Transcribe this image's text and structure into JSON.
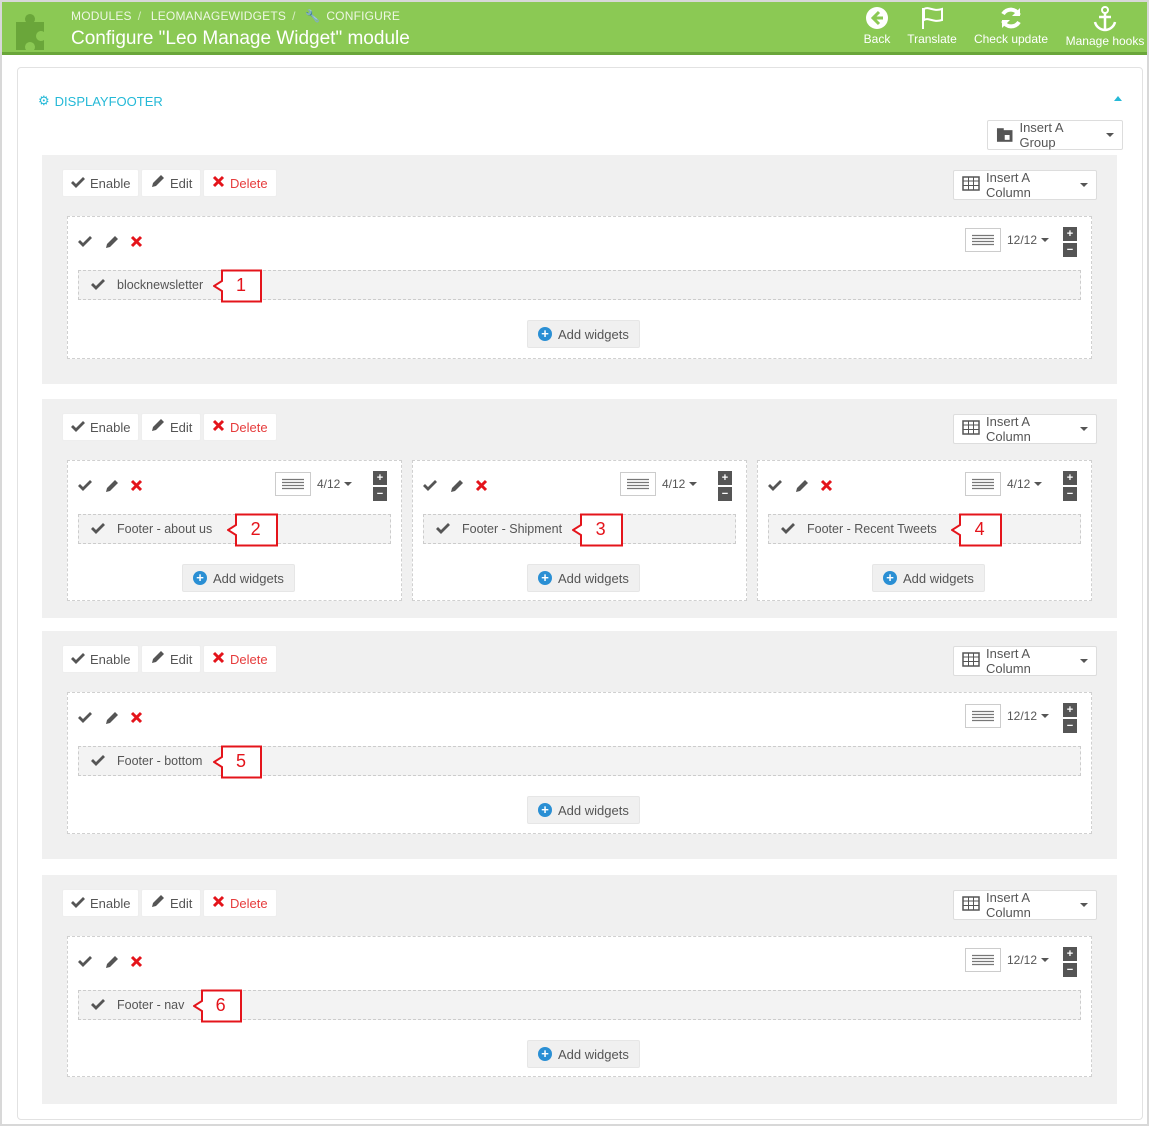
{
  "header": {
    "breadcrumb": [
      "MODULES",
      "LEOMANAGEWIDGETS",
      "CONFIGURE"
    ],
    "title": "Configure \"Leo Manage Widget\" module",
    "toolbar": {
      "back": "Back",
      "translate": "Translate",
      "check_update": "Check update",
      "manage_hooks": "Manage hooks"
    },
    "colors": {
      "bar": "#8bc954",
      "accent": "#25b9d7"
    }
  },
  "panel": {
    "title": "DISPLAYFOOTER",
    "insert_group": "Insert A Group"
  },
  "labels": {
    "enable": "Enable",
    "edit": "Edit",
    "delete": "Delete",
    "insert_column": "Insert A Column",
    "add_widgets": "Add widgets"
  },
  "rows": [
    {
      "columns": [
        {
          "width": "12/12",
          "widget": "blocknewsletter",
          "callout": "1"
        }
      ]
    },
    {
      "columns": [
        {
          "width": "4/12",
          "widget": "Footer - about us",
          "callout": "2"
        },
        {
          "width": "4/12",
          "widget": "Footer - Shipment",
          "callout": "3"
        },
        {
          "width": "4/12",
          "widget": "Footer - Recent Tweets",
          "callout": "4"
        }
      ]
    },
    {
      "columns": [
        {
          "width": "12/12",
          "widget": "Footer - bottom",
          "callout": "5"
        }
      ]
    },
    {
      "columns": [
        {
          "width": "12/12",
          "widget": "Footer - nav",
          "callout": "6"
        }
      ]
    }
  ]
}
